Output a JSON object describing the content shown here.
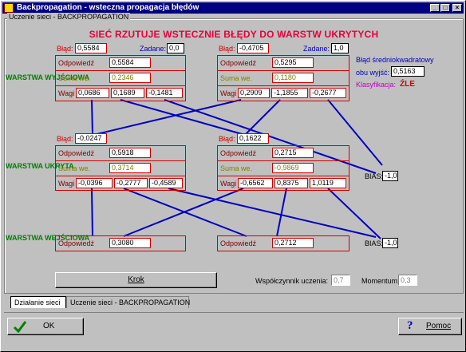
{
  "window": {
    "title": "Backpropagation - wsteczna propagacja błędów"
  },
  "group_title": "Uczenie sieci - BACKPROPAGATION",
  "header": "SIEĆ RZUTUJE WSTECZNIE BŁĘDY DO WARSTW UKRYTYCH",
  "layers": {
    "output": "WARSTWA WYJŚCIOWA",
    "hidden": "WARSTWA UKRYTA",
    "input": "WARSTWA WEJŚCIOWA"
  },
  "labels": {
    "error": "Błąd:",
    "target": "Zadane:",
    "response": "Odpowiedź",
    "sum": "Suma we.",
    "weights": "Wagi",
    "bias": "BIAS:",
    "mse_line1": "Błąd średniokwadratowy",
    "mse_line2": "obu wyjść:",
    "classification": "Klasyfikacja:"
  },
  "output_neurons": [
    {
      "error": "0,5584",
      "target": "0,0",
      "response": "0,5584",
      "sum": "0,2346",
      "weights": [
        "0,0686",
        "0,1689",
        "-0,1481"
      ]
    },
    {
      "error": "-0,4705",
      "target": "1,0",
      "response": "0,5295",
      "sum": "0,1180",
      "weights": [
        "0,2909",
        "-1,1855",
        "-0,2677"
      ]
    }
  ],
  "mse_value": "0,5163",
  "classification_value": "ŹLE",
  "hidden_neurons": [
    {
      "error": "-0,0247",
      "response": "0,5918",
      "sum": "0,3714",
      "weights": [
        "-0,0396",
        "-0,2777",
        "-0,4589"
      ]
    },
    {
      "error": "0,1622",
      "response": "0,2715",
      "sum": "-0,9869",
      "weights": [
        "-0,6562",
        "0,8375",
        "1,0119"
      ]
    }
  ],
  "hidden_bias": "-1,0",
  "input_neurons": [
    {
      "response": "0,3080"
    },
    {
      "response": "0,2712"
    }
  ],
  "input_bias": "-1,0",
  "krok_button": "Krok",
  "learning_rate_label": "Współczynnik uczenia:",
  "learning_rate_value": "0,7",
  "momentum_label": "Momentum:",
  "momentum_value": "0,3",
  "tabs": [
    "Działanie sieci",
    "Uczenie sieci - BACKPROPAGATION"
  ],
  "ok_button": "OK",
  "help_button": "Pomoc",
  "colors": {
    "title_bar": "#000080",
    "header": "#e8003a",
    "layer_label": "#008000",
    "connection": "#0000c0",
    "box_border": "#d00000"
  }
}
